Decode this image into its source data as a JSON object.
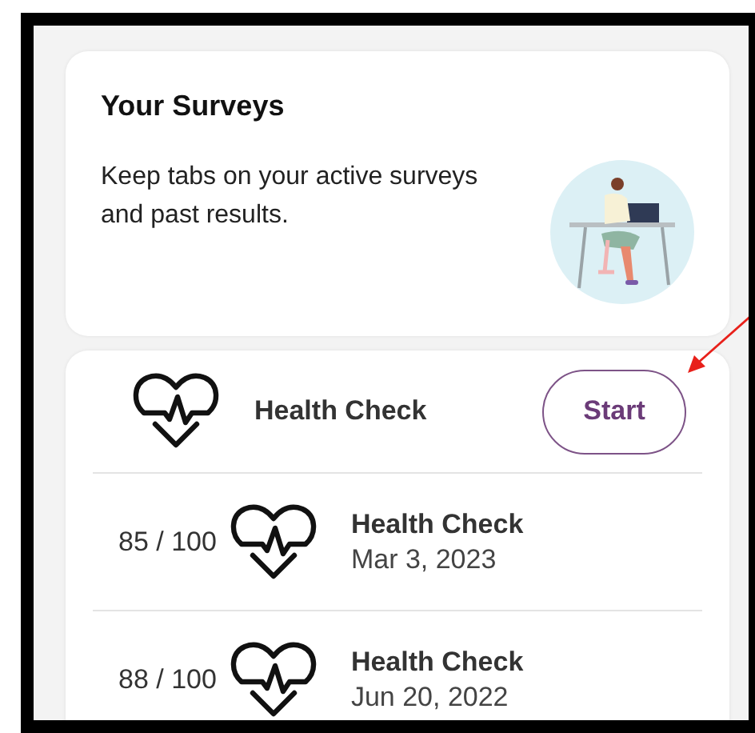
{
  "header": {
    "title": "Your Surveys",
    "description": "Keep tabs on your active surveys and past results."
  },
  "active_survey": {
    "name": "Health Check",
    "button": "Start"
  },
  "results": [
    {
      "score": "85 / 100",
      "name": "Health Check",
      "date": "Mar 3, 2023"
    },
    {
      "score": "88 / 100",
      "name": "Health Check",
      "date": "Jun 20, 2022"
    }
  ]
}
